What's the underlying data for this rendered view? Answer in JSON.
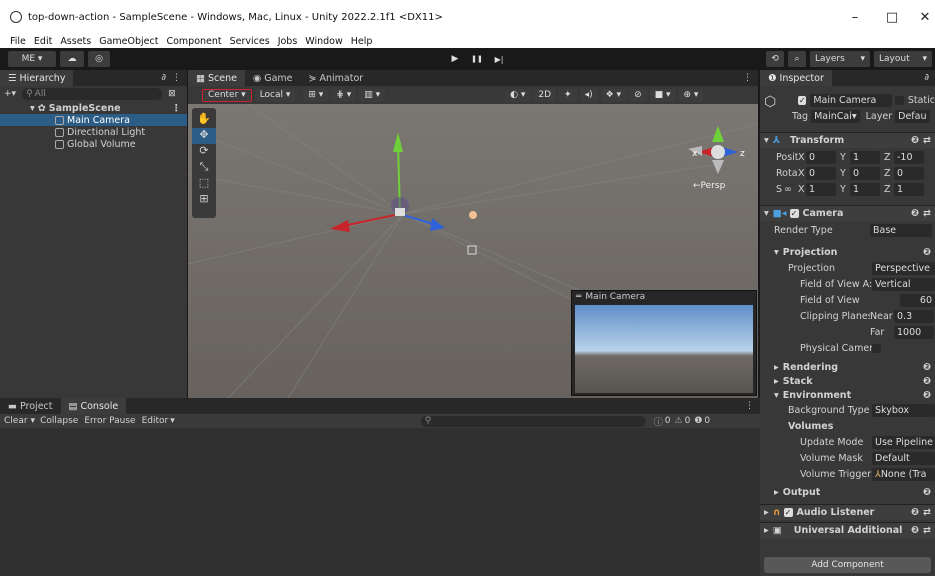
{
  "window": {
    "title": "top-down-action - SampleScene - Windows, Mac, Linux - Unity 2022.2.1f1 <DX11>",
    "min": "–",
    "max": "□",
    "close": "✕"
  },
  "menu": [
    "File",
    "Edit",
    "Assets",
    "GameObject",
    "Component",
    "Services",
    "Jobs",
    "Window",
    "Help"
  ],
  "toolbar": {
    "account": "ME ▾",
    "cloud": "☁",
    "collab": "◎",
    "play": "▶",
    "pause": "❚❚",
    "step": "▶|",
    "history": "⟲",
    "search": "⌕",
    "layers": "Layers",
    "layout": "Layout"
  },
  "hierarchy": {
    "tab": "Hierarchy",
    "lock": "∂",
    "add": "+▾",
    "search": "All",
    "scene": "SampleScene",
    "items": [
      "Main Camera",
      "Directional Light",
      "Global Volume"
    ]
  },
  "scene_tabs": [
    "Scene",
    "Game",
    "Animator"
  ],
  "scene_toolbar": {
    "pivot": "Center",
    "space": "Local",
    "mode2d": "2D"
  },
  "scene_view": {
    "persp": "←Persp",
    "x": "x",
    "z": "z",
    "preview_title": "Main Camera"
  },
  "bottom": {
    "tabs": [
      "Project",
      "Console"
    ],
    "clear": "Clear",
    "collapse": "Collapse",
    "error_pause": "Error Pause",
    "editor": "Editor",
    "counts": [
      "0",
      "0",
      "0"
    ]
  },
  "inspector": {
    "tab": "Inspector",
    "object_name": "Main Camera",
    "static": "Static",
    "tag_label": "Tag",
    "tag": "MainCai▾",
    "layer_label": "Layer",
    "layer": "Defau",
    "transform": {
      "title": "Transform",
      "rows": [
        {
          "label": "Positi",
          "x": "0",
          "y": "1",
          "z": "-10"
        },
        {
          "label": "Rotat",
          "x": "0",
          "y": "0",
          "z": "0"
        },
        {
          "label": "S",
          "x": "1",
          "y": "1",
          "z": "1"
        }
      ]
    },
    "camera": {
      "title": "Camera",
      "render_type_label": "Render Type",
      "render_type": "Base",
      "projection_title": "Projection",
      "projection_label": "Projection",
      "projection": "Perspective",
      "fov_axis_label": "Field of View A:",
      "fov_axis": "Vertical",
      "fov_label": "Field of View",
      "fov": "60",
      "clip_label": "Clipping Planes",
      "near_label": "Near",
      "near": "0.3",
      "far_label": "Far",
      "far": "1000",
      "physical_label": "Physical Camer"
    },
    "sections": {
      "rendering": "Rendering",
      "stack": "Stack",
      "environment": "Environment"
    },
    "env": {
      "bg_label": "Background Type",
      "bg": "Skybox",
      "volumes": "Volumes",
      "update_label": "Update Mode",
      "update": "Use Pipeline",
      "mask_label": "Volume Mask",
      "mask": "Default",
      "trigger_label": "Volume Trigger",
      "trigger": "None (Tra"
    },
    "output": "Output",
    "audio": "Audio Listener",
    "universal": "Universal Additional",
    "add_component": "Add Component"
  },
  "colors": {
    "accent": "#2c5d87",
    "x_axis": "#c8252b",
    "y_axis": "#6fd13a",
    "z_axis": "#2f62d8"
  }
}
